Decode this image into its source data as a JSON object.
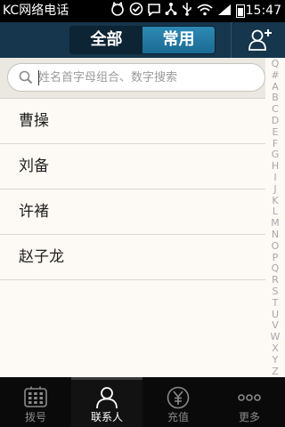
{
  "status_bar": {
    "app_name": "KC网络电话",
    "time": "15:47",
    "icons": [
      "cat-icon",
      "check-icon",
      "chat-icon",
      "share-icon",
      "usb-icon",
      "wifi-icon",
      "signal-icon",
      "battery-icon"
    ]
  },
  "header": {
    "tabs": [
      {
        "label": "全部",
        "active": true
      },
      {
        "label": "常用",
        "active": false
      }
    ],
    "add_contact_icon": "add-contact-icon"
  },
  "search": {
    "placeholder": "姓名首字母组合、数字搜索",
    "value": ""
  },
  "contacts": [
    "曹操",
    "刘备",
    "许褚",
    "赵子龙"
  ],
  "alphabet_index": [
    "Q",
    "#",
    "A",
    "B",
    "C",
    "D",
    "E",
    "F",
    "G",
    "H",
    "I",
    "J",
    "K",
    "L",
    "M",
    "N",
    "O",
    "P",
    "Q",
    "R",
    "S",
    "T",
    "U",
    "V",
    "W",
    "X",
    "Y",
    "Z"
  ],
  "bottom_nav": [
    {
      "label": "拨号",
      "icon": "dialpad-icon",
      "active": false
    },
    {
      "label": "联系人",
      "icon": "contacts-icon",
      "active": true
    },
    {
      "label": "充值",
      "icon": "yuan-icon",
      "active": false
    },
    {
      "label": "更多",
      "icon": "more-icon",
      "active": false
    }
  ],
  "colors": {
    "header_bg": "#15364c",
    "tab_active_bg": "#0d2434",
    "tab_inactive_bg": "#2c8ab4",
    "list_bg": "#fdf9f4",
    "nav_bg": "#0a0a0a"
  }
}
